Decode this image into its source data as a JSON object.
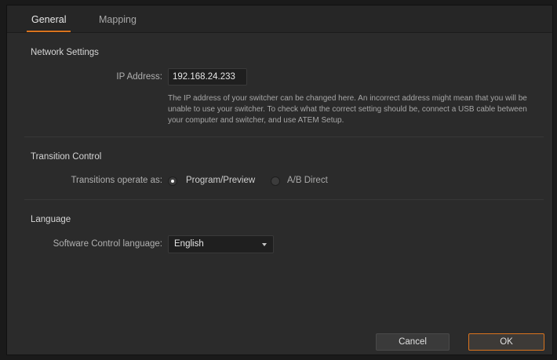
{
  "tabs": [
    {
      "label": "General",
      "active": true
    },
    {
      "label": "Mapping",
      "active": false
    }
  ],
  "network": {
    "section_title": "Network Settings",
    "ip_label": "IP Address:",
    "ip_value": "192.168.24.233",
    "help_text": "The IP address of your switcher can be changed here. An incorrect address might mean that you will be unable to use your switcher. To check what the correct setting should be, connect a USB cable between your computer and switcher, and use ATEM Setup."
  },
  "transition": {
    "section_title": "Transition Control",
    "label": "Transitions operate as:",
    "options": [
      {
        "label": "Program/Preview",
        "selected": true
      },
      {
        "label": "A/B Direct",
        "selected": false
      }
    ]
  },
  "language": {
    "section_title": "Language",
    "label": "Software Control language:",
    "selected": "English"
  },
  "buttons": {
    "cancel": "Cancel",
    "ok": "OK"
  },
  "colors": {
    "accent": "#d9731e",
    "panel": "#2b2b2b",
    "field": "#1f1f1f"
  }
}
